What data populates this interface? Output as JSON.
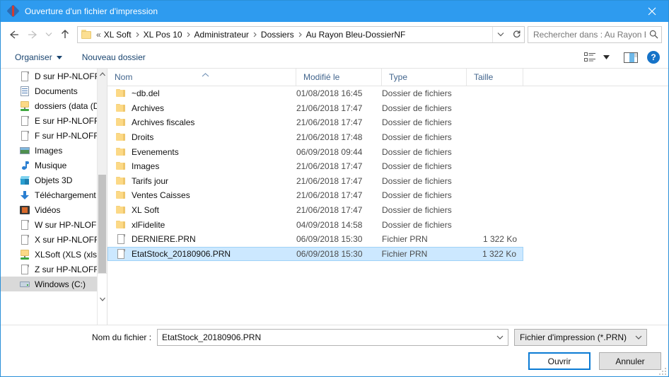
{
  "window": {
    "title": "Ouverture d'un fichier d'impression",
    "app_icon": "printer-diamond-icon",
    "close_label": "✕"
  },
  "navigation": {
    "back_icon": "arrow-left-icon",
    "forward_icon": "arrow-right-icon",
    "recent_icon": "chevron-down-icon",
    "up_icon": "arrow-up-icon",
    "refresh_icon": "refresh-icon",
    "breadcrumb_lead": "«",
    "breadcrumbs": [
      "XL Soft",
      "XL Pos 10",
      "Administrateur",
      "Dossiers",
      "Au Rayon Bleu-DossierNF"
    ],
    "breadcrumb_dropdown_icon": "chevron-down-icon"
  },
  "search": {
    "placeholder": "Rechercher dans : Au Rayon B...",
    "icon": "search-icon"
  },
  "toolbar": {
    "organize_label": "Organiser",
    "new_folder_label": "Nouveau dossier",
    "view_icon": "list-view-icon",
    "view_dropdown_icon": "chevron-down-icon",
    "preview_pane_icon": "preview-pane-icon",
    "help_label": "?",
    "help_icon": "help-icon"
  },
  "sidebar": {
    "items": [
      {
        "label": "D sur HP-NLOFF",
        "icon": "drive-doc-icon",
        "selected": false
      },
      {
        "label": "Documents",
        "icon": "documents-icon",
        "selected": false
      },
      {
        "label": "dossiers (data (D",
        "icon": "network-folder-icon",
        "selected": false
      },
      {
        "label": "E sur HP-NLOFF",
        "icon": "drive-doc-icon",
        "selected": false
      },
      {
        "label": "F sur HP-NLOFF",
        "icon": "drive-doc-icon",
        "selected": false
      },
      {
        "label": "Images",
        "icon": "pictures-icon",
        "selected": false
      },
      {
        "label": "Musique",
        "icon": "music-icon",
        "selected": false
      },
      {
        "label": "Objets 3D",
        "icon": "3d-objects-icon",
        "selected": false
      },
      {
        "label": "Téléchargement",
        "icon": "downloads-icon",
        "selected": false
      },
      {
        "label": "Vidéos",
        "icon": "videos-icon",
        "selected": false
      },
      {
        "label": "W sur HP-NLOFF",
        "icon": "drive-doc-icon",
        "selected": false
      },
      {
        "label": "X sur HP-NLOFF",
        "icon": "drive-doc-icon",
        "selected": false
      },
      {
        "label": "XLSoft (XLS (xls)",
        "icon": "network-folder-icon",
        "selected": false
      },
      {
        "label": "Z sur HP-NLOFF",
        "icon": "drive-doc-icon",
        "selected": false
      },
      {
        "label": "Windows (C:)",
        "icon": "hard-drive-icon",
        "selected": true
      }
    ],
    "scroll_up_icon": "chevron-up-icon",
    "scroll_down_icon": "chevron-down-icon"
  },
  "filelist": {
    "columns": [
      "Nom",
      "Modifié le",
      "Type",
      "Taille"
    ],
    "sort_column": "Nom",
    "sort_caret": "▲",
    "rows": [
      {
        "name": "~db.del",
        "modified": "01/08/2018 16:45",
        "type": "Dossier de fichiers",
        "size": "",
        "icon": "folder-icon",
        "selected": false
      },
      {
        "name": "Archives",
        "modified": "21/06/2018 17:47",
        "type": "Dossier de fichiers",
        "size": "",
        "icon": "folder-icon",
        "selected": false
      },
      {
        "name": "Archives fiscales",
        "modified": "21/06/2018 17:47",
        "type": "Dossier de fichiers",
        "size": "",
        "icon": "folder-icon",
        "selected": false
      },
      {
        "name": "Droits",
        "modified": "21/06/2018 17:48",
        "type": "Dossier de fichiers",
        "size": "",
        "icon": "folder-icon",
        "selected": false
      },
      {
        "name": "Evenements",
        "modified": "06/09/2018 09:44",
        "type": "Dossier de fichiers",
        "size": "",
        "icon": "folder-icon",
        "selected": false
      },
      {
        "name": "Images",
        "modified": "21/06/2018 17:47",
        "type": "Dossier de fichiers",
        "size": "",
        "icon": "folder-icon",
        "selected": false
      },
      {
        "name": "Tarifs jour",
        "modified": "21/06/2018 17:47",
        "type": "Dossier de fichiers",
        "size": "",
        "icon": "folder-icon",
        "selected": false
      },
      {
        "name": "Ventes Caisses",
        "modified": "21/06/2018 17:47",
        "type": "Dossier de fichiers",
        "size": "",
        "icon": "folder-icon",
        "selected": false
      },
      {
        "name": "XL Soft",
        "modified": "21/06/2018 17:47",
        "type": "Dossier de fichiers",
        "size": "",
        "icon": "folder-icon",
        "selected": false
      },
      {
        "name": "xlFidelite",
        "modified": "04/09/2018 14:58",
        "type": "Dossier de fichiers",
        "size": "",
        "icon": "folder-icon",
        "selected": false
      },
      {
        "name": "DERNIERE.PRN",
        "modified": "06/09/2018 15:30",
        "type": "Fichier PRN",
        "size": "1 322 Ko",
        "icon": "file-icon",
        "selected": false
      },
      {
        "name": "EtatStock_20180906.PRN",
        "modified": "06/09/2018 15:30",
        "type": "Fichier PRN",
        "size": "1 322 Ko",
        "icon": "file-icon",
        "selected": true
      }
    ]
  },
  "footer": {
    "filename_label": "Nom du fichier :",
    "filename_value": "EtatStock_20180906.PRN",
    "filename_dropdown_icon": "chevron-down-icon",
    "filter_value": "Fichier d'impression (*.PRN)",
    "filter_dropdown_icon": "chevron-down-icon",
    "open_label": "Ouvrir",
    "cancel_label": "Annuler"
  }
}
